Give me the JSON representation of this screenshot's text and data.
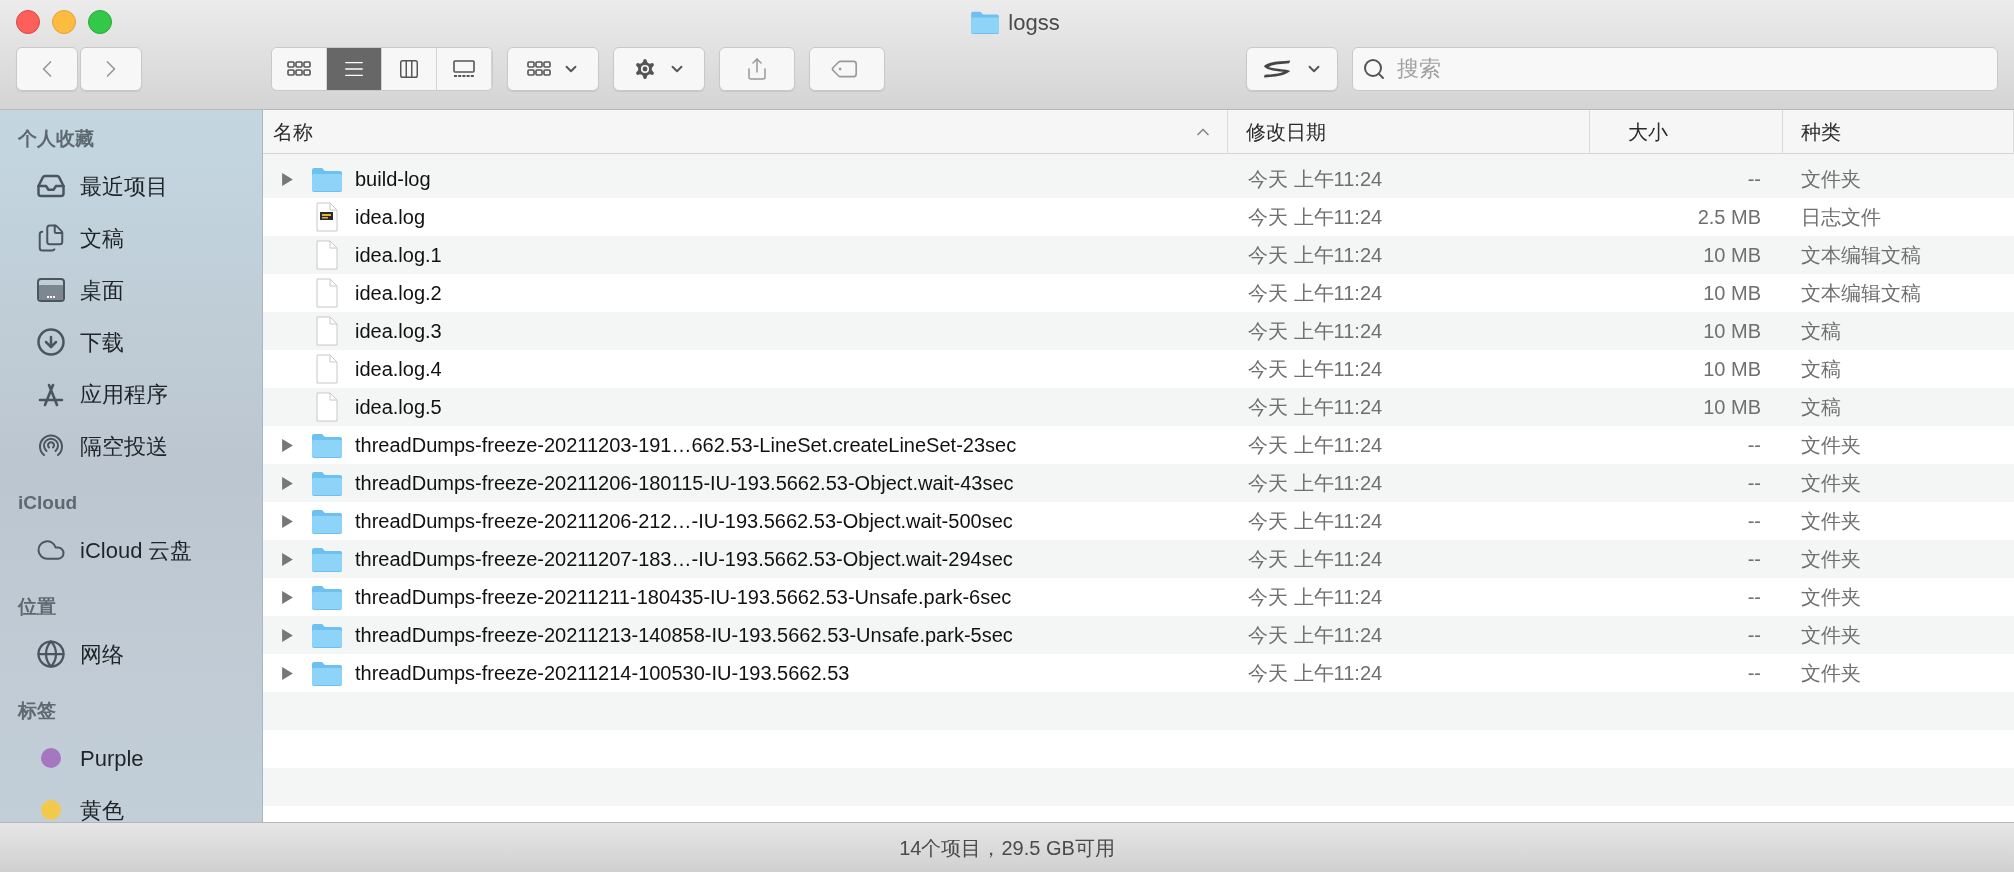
{
  "window": {
    "title": "logss"
  },
  "toolbar": {
    "view_modes": [
      {
        "kind": "icons",
        "selected": false
      },
      {
        "kind": "list",
        "selected": true
      },
      {
        "kind": "columns",
        "selected": false
      },
      {
        "kind": "gallery",
        "selected": false
      }
    ]
  },
  "search": {
    "placeholder": "搜索"
  },
  "sidebar": {
    "sections": [
      {
        "heading": "个人收藏",
        "items": [
          {
            "kind": "recents",
            "label": "最近项目"
          },
          {
            "kind": "documents",
            "label": "文稿"
          },
          {
            "kind": "desktop",
            "label": "桌面"
          },
          {
            "kind": "downloads",
            "label": "下载"
          },
          {
            "kind": "applications",
            "label": "应用程序"
          },
          {
            "kind": "airdrop",
            "label": "隔空投送"
          }
        ]
      },
      {
        "heading": "iCloud",
        "items": [
          {
            "kind": "cloud",
            "label": "iCloud 云盘"
          }
        ]
      },
      {
        "heading": "位置",
        "items": [
          {
            "kind": "network",
            "label": "网络"
          }
        ]
      },
      {
        "heading": "标签",
        "items": [
          {
            "kind": "tag",
            "label": "Purple",
            "color": "#a477c0"
          },
          {
            "kind": "tag",
            "label": "黄色",
            "color": "#f2c94c"
          }
        ]
      }
    ]
  },
  "table": {
    "columns": [
      {
        "label": "名称",
        "sorted": true
      },
      {
        "label": "修改日期",
        "sorted": false
      },
      {
        "label": "大小",
        "sorted": false
      },
      {
        "label": "种类",
        "sorted": false
      }
    ],
    "rows": [
      {
        "kind": "folder",
        "expanded": false,
        "name": "build-log",
        "date": "今天 上午11:24",
        "size": "--",
        "type": "文件夹"
      },
      {
        "kind": "log",
        "name": "idea.log",
        "date": "今天 上午11:24",
        "size": "2.5 MB",
        "type": "日志文件"
      },
      {
        "kind": "text",
        "name": "idea.log.1",
        "date": "今天 上午11:24",
        "size": "10 MB",
        "type": "文本编辑文稿"
      },
      {
        "kind": "text",
        "name": "idea.log.2",
        "date": "今天 上午11:24",
        "size": "10 MB",
        "type": "文本编辑文稿"
      },
      {
        "kind": "text",
        "name": "idea.log.3",
        "date": "今天 上午11:24",
        "size": "10 MB",
        "type": "文稿"
      },
      {
        "kind": "text",
        "name": "idea.log.4",
        "date": "今天 上午11:24",
        "size": "10 MB",
        "type": "文稿"
      },
      {
        "kind": "text",
        "name": "idea.log.5",
        "date": "今天 上午11:24",
        "size": "10 MB",
        "type": "文稿"
      },
      {
        "kind": "folder",
        "expanded": false,
        "name": "threadDumps-freeze-20211203-191…662.53-LineSet.createLineSet-23sec",
        "date": "今天 上午11:24",
        "size": "--",
        "type": "文件夹"
      },
      {
        "kind": "folder",
        "expanded": false,
        "name": "threadDumps-freeze-20211206-180115-IU-193.5662.53-Object.wait-43sec",
        "date": "今天 上午11:24",
        "size": "--",
        "type": "文件夹"
      },
      {
        "kind": "folder",
        "expanded": false,
        "name": "threadDumps-freeze-20211206-212…-IU-193.5662.53-Object.wait-500sec",
        "date": "今天 上午11:24",
        "size": "--",
        "type": "文件夹"
      },
      {
        "kind": "folder",
        "expanded": false,
        "name": "threadDumps-freeze-20211207-183…-IU-193.5662.53-Object.wait-294sec",
        "date": "今天 上午11:24",
        "size": "--",
        "type": "文件夹"
      },
      {
        "kind": "folder",
        "expanded": false,
        "name": "threadDumps-freeze-20211211-180435-IU-193.5662.53-Unsafe.park-6sec",
        "date": "今天 上午11:24",
        "size": "--",
        "type": "文件夹"
      },
      {
        "kind": "folder",
        "expanded": false,
        "name": "threadDumps-freeze-20211213-140858-IU-193.5662.53-Unsafe.park-5sec",
        "date": "今天 上午11:24",
        "size": "--",
        "type": "文件夹"
      },
      {
        "kind": "folder",
        "expanded": false,
        "name": "threadDumps-freeze-20211214-100530-IU-193.5662.53",
        "date": "今天 上午11:24",
        "size": "--",
        "type": "文件夹"
      }
    ]
  },
  "status_bar": {
    "text": "14个项目，29.5 GB可用"
  }
}
